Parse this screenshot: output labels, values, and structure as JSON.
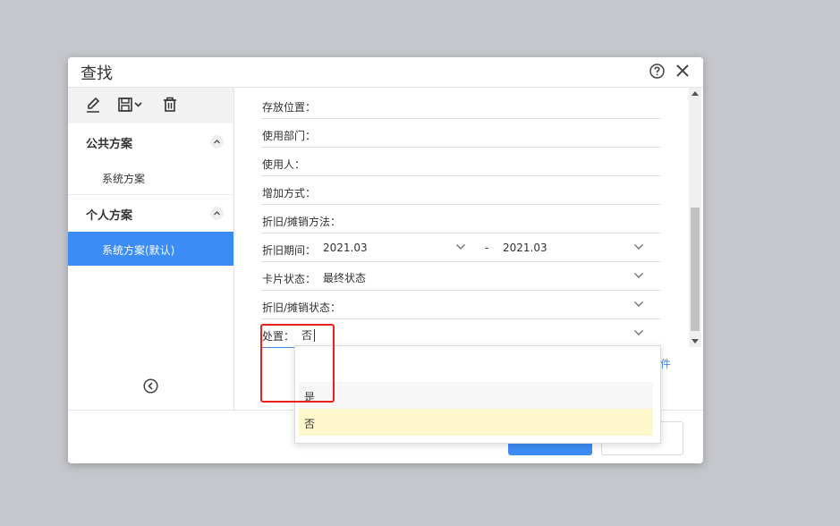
{
  "dialog": {
    "title": "查找",
    "help_icon": "help-circle-icon",
    "close_icon": "close-icon"
  },
  "sidebar": {
    "toolbar": [
      "edit-pen-icon",
      "save-dropdown-icon",
      "delete-trash-icon"
    ],
    "public_section": {
      "label": "公共方案",
      "items": [
        "系统方案"
      ]
    },
    "personal_section": {
      "label": "个人方案",
      "items": [
        "系统方案(默认)"
      ]
    },
    "collapse_icon": "collapse-left-icon"
  },
  "form": {
    "rows": [
      {
        "label": "存放位置：",
        "value": ""
      },
      {
        "label": "使用部门：",
        "value": ""
      },
      {
        "label": "使用人：",
        "value": ""
      },
      {
        "label": "增加方式：",
        "value": ""
      },
      {
        "label": "折旧/摊销方法：",
        "value": ""
      },
      {
        "label": "折旧期间：",
        "value_from": "2021.03",
        "separator": "-",
        "value_to": "2021.03"
      },
      {
        "label": "卡片状态：",
        "value": "最终状态"
      },
      {
        "label": "折旧/摊销状态：",
        "value": ""
      },
      {
        "label": "处置：",
        "value": "否"
      }
    ],
    "partial_link": "件"
  },
  "dropdown": {
    "options": [
      "",
      "是",
      "否"
    ],
    "selected": "否"
  },
  "colors": {
    "accent": "#3c8cf5",
    "highlight": "#e8201e",
    "selected_option": "#fff7cc"
  }
}
